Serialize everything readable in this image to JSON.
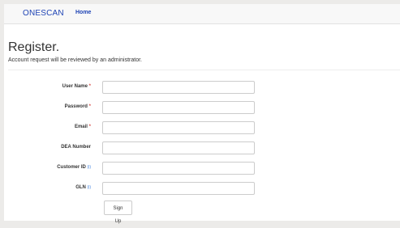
{
  "nav": {
    "brand": "ONESCAN",
    "home": "Home"
  },
  "page": {
    "title": "Register.",
    "subtitle": "Account request will be reviewed by an administrator."
  },
  "form": {
    "fields": [
      {
        "label": "User Name",
        "required": "*",
        "info": "",
        "value": ""
      },
      {
        "label": "Password",
        "required": "*",
        "info": "",
        "value": ""
      },
      {
        "label": "Email",
        "required": "*",
        "info": "",
        "value": ""
      },
      {
        "label": "DEA Number",
        "required": "",
        "info": "",
        "value": ""
      },
      {
        "label": "Customer ID",
        "required": "",
        "info": "(i)",
        "value": ""
      },
      {
        "label": "GLN",
        "required": "",
        "info": "(i)",
        "value": ""
      }
    ],
    "submit_label": "Sign Up"
  }
}
